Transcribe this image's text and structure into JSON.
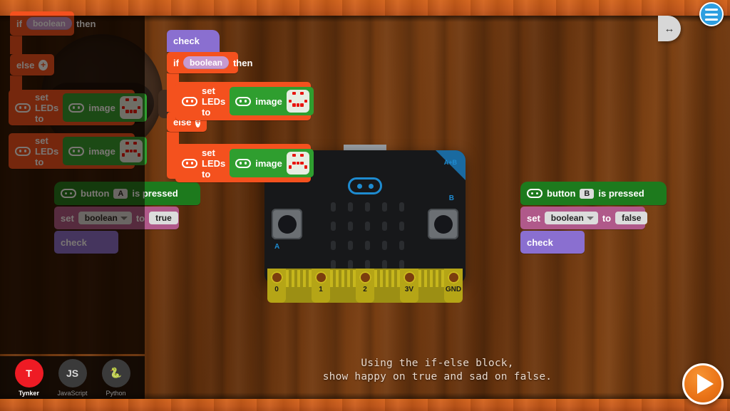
{
  "app": {
    "caption_line1": "Using the if-else block,",
    "caption_line2": "show happy on true and sad on false."
  },
  "controls": {
    "menu_icon": "hamburger-menu-icon",
    "expand_icon": "↔",
    "play_icon": "play-triangle-icon"
  },
  "left_panel": {
    "languages": [
      {
        "label": "Tynker",
        "glyph": "T",
        "active": true
      },
      {
        "label": "JavaScript",
        "glyph": "JS",
        "active": false
      },
      {
        "label": "Python",
        "glyph": "🐍",
        "active": false
      }
    ],
    "palette_blocks": {
      "if_else": {
        "if_label": "if",
        "condition": "boolean",
        "then_label": "then",
        "else_label": "else",
        "plus_label": "+"
      },
      "set_leds_1": {
        "label": "set LEDs to",
        "image_label": "image"
      },
      "set_leds_2": {
        "label": "set LEDs to",
        "image_label": "image"
      }
    },
    "script_a": {
      "hat": {
        "prefix": "button",
        "button": "A",
        "suffix": "is pressed"
      },
      "set": {
        "set_label": "set",
        "variable": "boolean",
        "to_label": "to",
        "value": "true"
      },
      "call": {
        "label": "check"
      }
    }
  },
  "workspace": {
    "check_script": {
      "define_label": "check",
      "if_label": "if",
      "condition": "boolean",
      "then_label": "then",
      "else_label": "else",
      "plus_label": "+",
      "then_body": {
        "label": "set LEDs to",
        "image_label": "image"
      },
      "else_body": {
        "label": "set LEDs to",
        "image_label": "image"
      }
    },
    "script_b": {
      "hat": {
        "prefix": "button",
        "button": "B",
        "suffix": "is pressed"
      },
      "set": {
        "set_label": "set",
        "variable": "boolean",
        "to_label": "to",
        "value": "false"
      },
      "call": {
        "label": "check"
      }
    }
  },
  "microbit": {
    "logo_label": "microbit-logo",
    "button_a_label": "A",
    "button_b_label": "B",
    "button_ab_label": "A+B",
    "pins": [
      "0",
      "1",
      "2",
      "3V",
      "GND"
    ],
    "led_matrix_on": []
  },
  "led_patterns": {
    "happy": [
      [
        0,
        1,
        0,
        1,
        0
      ],
      [
        0,
        0,
        0,
        0,
        0
      ],
      [
        1,
        0,
        0,
        0,
        1
      ],
      [
        0,
        1,
        1,
        1,
        0
      ],
      [
        0,
        0,
        0,
        0,
        0
      ]
    ],
    "sad": [
      [
        0,
        1,
        0,
        1,
        0
      ],
      [
        0,
        0,
        0,
        0,
        0
      ],
      [
        0,
        1,
        1,
        1,
        0
      ],
      [
        1,
        0,
        0,
        0,
        1
      ],
      [
        0,
        0,
        0,
        0,
        0
      ]
    ]
  },
  "colors": {
    "control_orange": "#f4511e",
    "led_green": "#2f9e2f",
    "event_green": "#2f9e2f",
    "variable_pink": "#b0598a",
    "function_purple": "#8a6fd0",
    "boolean_lilac": "#c79ad0",
    "accent_blue": "#2e9fe0",
    "play_orange": "#ea7317",
    "wood_brown": "#6b350f"
  }
}
